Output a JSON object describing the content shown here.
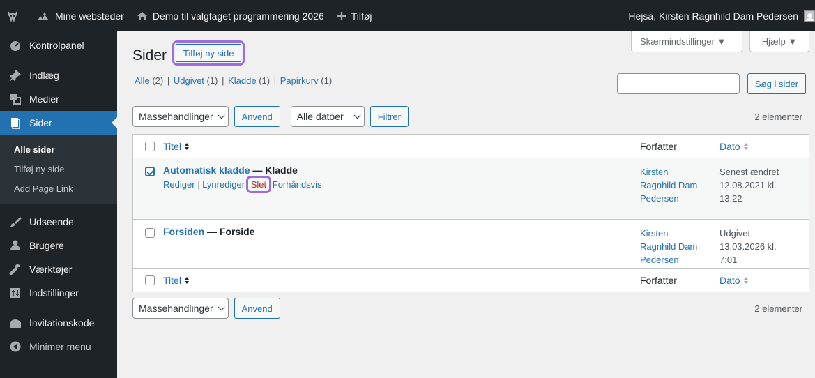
{
  "adminbar": {
    "my_sites": "Mine websteder",
    "site_name": "Demo til valgfaget programmering 2026",
    "add_new": "Tilføj",
    "greeting": "Hejsa, Kirsten Ragnhild Dam Pedersen"
  },
  "sidebar": {
    "items": [
      {
        "label": "Kontrolpanel",
        "icon": "dashboard-icon"
      },
      {
        "label": "Indlæg",
        "icon": "pin-icon"
      },
      {
        "label": "Medier",
        "icon": "media-icon"
      },
      {
        "label": "Sider",
        "icon": "page-icon"
      },
      {
        "label": "Udseende",
        "icon": "brush-icon"
      },
      {
        "label": "Brugere",
        "icon": "users-icon"
      },
      {
        "label": "Værktøjer",
        "icon": "wrench-icon"
      },
      {
        "label": "Indstillinger",
        "icon": "settings-icon"
      },
      {
        "label": "Invitationskode",
        "icon": "invite-icon"
      },
      {
        "label": "Minimer menu",
        "icon": "collapse-icon"
      }
    ],
    "submenu": [
      "Alle sider",
      "Tilføj ny side",
      "Add Page Link"
    ]
  },
  "header": {
    "screen_options": "Skærmindstillinger ▼",
    "help": "Hjælp ▼",
    "title": "Sider",
    "add_new": "Tilføj ny side"
  },
  "filters": {
    "all": "Alle",
    "all_count": "(2)",
    "published": "Udgivet",
    "published_count": "(1)",
    "draft": "Kladde",
    "draft_count": "(1)",
    "trash": "Papirkurv",
    "trash_count": "(1)",
    "sep": "|"
  },
  "search": {
    "button": "Søg i sider",
    "placeholder": ""
  },
  "bulk": {
    "actions": "Massehandlinger",
    "apply": "Anvend",
    "dates": "Alle datoer",
    "filter": "Filtrer",
    "count": "2 elementer"
  },
  "table": {
    "col_title": "Titel",
    "col_author": "Forfatter",
    "col_date": "Dato",
    "rows": [
      {
        "title": "Automatisk kladde",
        "state": "— Kladde",
        "checked": true,
        "actions": {
          "edit": "Rediger",
          "quick": "Lynrediger",
          "trash": "Slet",
          "preview": "Forhåndsvis"
        },
        "author_1": "Kirsten",
        "author_2": "Ragnhild Dam",
        "author_3": "Pedersen",
        "date_1": "Senest ændret",
        "date_2": "12.08.2021 kl.",
        "date_3": "13:22"
      },
      {
        "title": "Forsiden",
        "state": "— Forside",
        "checked": false,
        "author_1": "Kirsten",
        "author_2": "Ragnhild Dam",
        "author_3": "Pedersen",
        "date_1": "Udgivet",
        "date_2": "13.03.2026 kl.",
        "date_3": "7:01"
      }
    ]
  },
  "colors": {
    "accent": "#2271b1",
    "highlight": "#9b6ddf",
    "danger": "#b32d2e",
    "bar": "#1d2327"
  }
}
